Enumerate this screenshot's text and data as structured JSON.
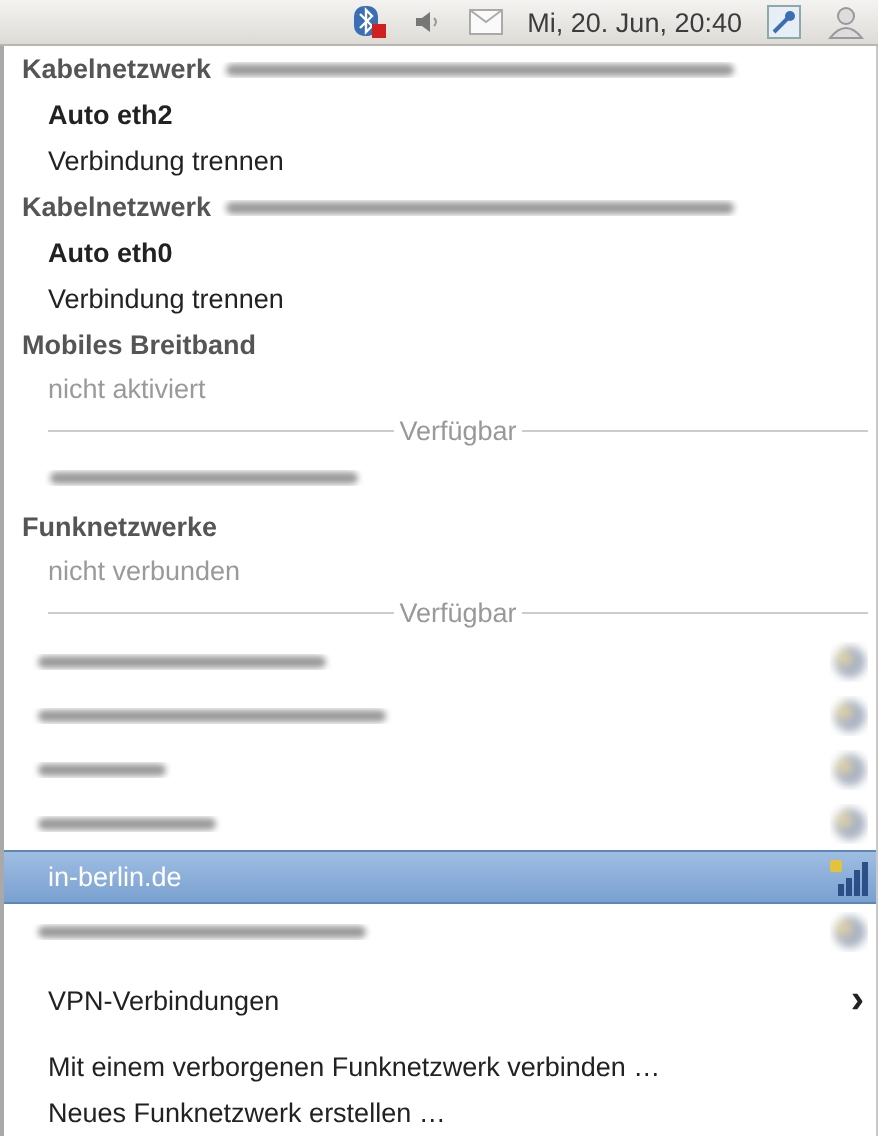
{
  "panel": {
    "clock": "Mi, 20. Jun, 20:40"
  },
  "menu": [
    {
      "kind": "header",
      "label": "Kabelnetzwerk",
      "blurred_suffix": true
    },
    {
      "kind": "connection",
      "label": "Auto eth2"
    },
    {
      "kind": "action",
      "label": "Verbindung trennen"
    },
    {
      "kind": "header",
      "label": "Kabelnetzwerk",
      "blurred_suffix": true
    },
    {
      "kind": "connection",
      "label": "Auto eth0"
    },
    {
      "kind": "action",
      "label": "Verbindung trennen"
    },
    {
      "kind": "header",
      "label": "Mobiles Breitband",
      "blurred_suffix": false
    },
    {
      "kind": "status",
      "label": "nicht aktiviert"
    },
    {
      "kind": "separator",
      "label": "Verfügbar"
    },
    {
      "kind": "blurred"
    },
    {
      "kind": "header",
      "label": "Funknetzwerke",
      "blurred_suffix": false
    },
    {
      "kind": "status",
      "label": "nicht verbunden"
    },
    {
      "kind": "separator",
      "label": "Verfügbar"
    },
    {
      "kind": "network",
      "selected": false
    },
    {
      "kind": "network",
      "selected": false
    },
    {
      "kind": "network",
      "selected": false
    },
    {
      "kind": "network",
      "selected": false
    },
    {
      "kind": "network",
      "label": "in-berlin.de",
      "selected": true
    },
    {
      "kind": "network",
      "selected": false
    },
    {
      "kind": "divider"
    },
    {
      "kind": "submenu",
      "label": "VPN-Verbindungen",
      "arrow": "›"
    },
    {
      "kind": "divider"
    },
    {
      "kind": "action",
      "label": "Mit einem verborgenen Funknetzwerk verbinden …"
    },
    {
      "kind": "action",
      "label": "Neues Funknetzwerk erstellen …"
    }
  ]
}
